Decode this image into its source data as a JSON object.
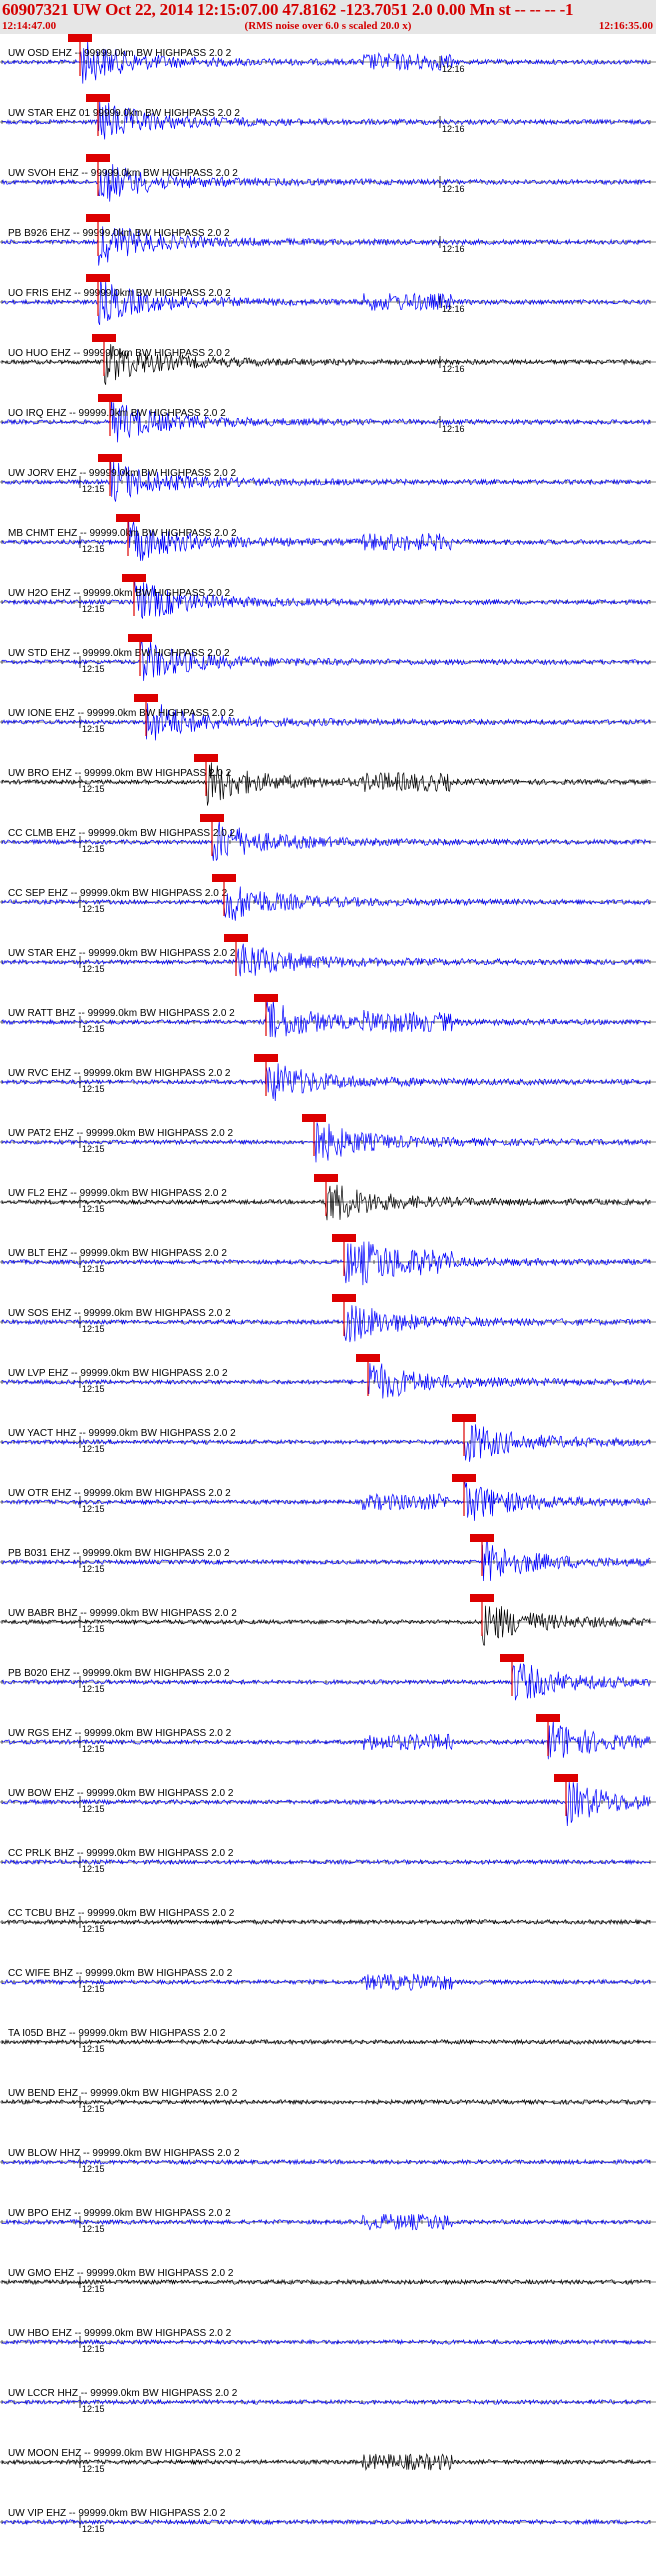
{
  "header": {
    "title": "60907321 UW Oct 22, 2014 12:15:07.00   47.8162 -123.7051  2.0 0.00 Mn st -- -- --  -1",
    "subtitle": "(RMS noise over 6.0 s scaled 20.0 x)",
    "start_time": "12:14:47.00",
    "end_time": "12:16:35.00"
  },
  "chart_data": {
    "type": "seismogram",
    "time_range": [
      "12:14:47.00",
      "12:16:35.00"
    ],
    "minute_marks": [
      {
        "label": "12:15",
        "t_sec": 13
      },
      {
        "label": "12:16",
        "t_sec": 73
      }
    ],
    "trace_color": "#0000ff",
    "alt_trace_color": "#000000",
    "pick_color": "#dd0000",
    "traces": [
      {
        "label": "UW OSD EHZ -- 99999.0km BW  HIGHPASS  2.0  2",
        "pick_t": 13,
        "tick": "12:16"
      },
      {
        "label": "UW STAR EHZ 01 99999.0km BW  HIGHPASS  2.0  2",
        "pick_t": 16,
        "tick": "12:16"
      },
      {
        "label": "UW SVOH EHZ -- 99999.0km BW  HIGHPASS  2.0  2",
        "pick_t": 16,
        "tick": "12:16"
      },
      {
        "label": "PB B926 EHZ -- 99999.0km BW  HIGHPASS  2.0  2",
        "pick_t": 16,
        "tick": "12:16"
      },
      {
        "label": "UO FRIS EHZ -- 99999.0km BW  HIGHPASS  2.0  2",
        "pick_t": 16,
        "tick": "12:16"
      },
      {
        "label": "UO HUO EHZ -- 99999.0km BW  HIGHPASS  2.0  2",
        "pick_t": 17,
        "tick": "12:16"
      },
      {
        "label": "UO IRQ EHZ -- 99999.0km BW  HIGHPASS  2.0  2",
        "pick_t": 18,
        "tick": "12:16"
      },
      {
        "label": "UW JORV EHZ -- 99999.0km BW  HIGHPASS  2.0  2",
        "pick_t": 18,
        "tick": "12:15"
      },
      {
        "label": "MB CHMT EHZ -- 99999.0km BW  HIGHPASS  2.0  2",
        "pick_t": 21,
        "tick": "12:15"
      },
      {
        "label": "UW H2O EHZ -- 99999.0km BW  HIGHPASS  2.0  2",
        "pick_t": 22,
        "tick": "12:15"
      },
      {
        "label": "UW STD EHZ -- 99999.0km BW  HIGHPASS  2.0  2",
        "pick_t": 23,
        "tick": "12:15"
      },
      {
        "label": "UW IONE EHZ -- 99999.0km BW  HIGHPASS  2.0  2",
        "pick_t": 24,
        "tick": "12:15"
      },
      {
        "label": "UW BRO EHZ -- 99999.0km BW  HIGHPASS  2.0  2",
        "pick_t": 34,
        "tick": "12:15"
      },
      {
        "label": "CC CLMB EHZ -- 99999.0km BW  HIGHPASS  2.0  2",
        "pick_t": 35,
        "tick": "12:15"
      },
      {
        "label": "CC SEP EHZ -- 99999.0km BW  HIGHPASS  2.0  2",
        "pick_t": 37,
        "tick": "12:15"
      },
      {
        "label": "UW STAR EHZ -- 99999.0km BW  HIGHPASS  2.0  2",
        "pick_t": 39,
        "tick": "12:15"
      },
      {
        "label": "UW RATT BHZ -- 99999.0km BW  HIGHPASS  2.0  2",
        "pick_t": 44,
        "tick": "12:15"
      },
      {
        "label": "UW RVC EHZ -- 99999.0km BW  HIGHPASS  2.0  2",
        "pick_t": 44,
        "tick": "12:15"
      },
      {
        "label": "UW PAT2 EHZ -- 99999.0km BW  HIGHPASS  2.0  2",
        "pick_t": 52,
        "tick": "12:15"
      },
      {
        "label": "UW FL2 EHZ -- 99999.0km BW  HIGHPASS  2.0  2",
        "pick_t": 54,
        "tick": "12:15"
      },
      {
        "label": "UW BLT EHZ -- 99999.0km BW  HIGHPASS  2.0  2",
        "pick_t": 57,
        "tick": "12:15"
      },
      {
        "label": "UW SOS EHZ -- 99999.0km BW  HIGHPASS  2.0  2",
        "pick_t": 57,
        "tick": "12:15"
      },
      {
        "label": "UW LVP EHZ -- 99999.0km BW  HIGHPASS  2.0  2",
        "pick_t": 61,
        "tick": "12:15"
      },
      {
        "label": "UW YACT HHZ -- 99999.0km BW  HIGHPASS  2.0  2",
        "pick_t": 77,
        "tick": "12:15"
      },
      {
        "label": "UW OTR EHZ -- 99999.0km BW  HIGHPASS  2.0  2",
        "pick_t": 77,
        "tick": "12:15"
      },
      {
        "label": "PB B031 EHZ -- 99999.0km BW  HIGHPASS  2.0  2",
        "pick_t": 80,
        "tick": "12:15"
      },
      {
        "label": "UW BABR BHZ -- 99999.0km BW  HIGHPASS  2.0  2",
        "pick_t": 80,
        "tick": "12:15"
      },
      {
        "label": "PB B020 EHZ -- 99999.0km BW  HIGHPASS  2.0  2",
        "pick_t": 85,
        "tick": "12:15"
      },
      {
        "label": "UW RGS EHZ -- 99999.0km BW  HIGHPASS  2.0  2",
        "pick_t": 91,
        "tick": "12:15"
      },
      {
        "label": "UW BOW EHZ -- 99999.0km BW  HIGHPASS  2.0  2",
        "pick_t": 94,
        "tick": "12:15"
      },
      {
        "label": "CC PRLK BHZ -- 99999.0km BW  HIGHPASS  2.0  2",
        "pick_t": null,
        "tick": "12:15"
      },
      {
        "label": "CC TCBU BHZ -- 99999.0km BW  HIGHPASS  2.0  2",
        "pick_t": null,
        "tick": "12:15"
      },
      {
        "label": "CC WIFE BHZ -- 99999.0km BW  HIGHPASS  2.0  2",
        "pick_t": null,
        "tick": "12:15"
      },
      {
        "label": "TA I05D BHZ -- 99999.0km BW  HIGHPASS  2.0  2",
        "pick_t": null,
        "tick": "12:15"
      },
      {
        "label": "UW BEND EHZ -- 99999.0km BW  HIGHPASS  2.0  2",
        "pick_t": null,
        "tick": "12:15"
      },
      {
        "label": "UW BLOW HHZ -- 99999.0km BW  HIGHPASS  2.0  2",
        "pick_t": null,
        "tick": "12:15"
      },
      {
        "label": "UW BPO EHZ -- 99999.0km BW  HIGHPASS  2.0  2",
        "pick_t": null,
        "tick": "12:15"
      },
      {
        "label": "UW GMO EHZ -- 99999.0km BW  HIGHPASS  2.0  2",
        "pick_t": null,
        "tick": "12:15"
      },
      {
        "label": "UW HBO EHZ -- 99999.0km BW  HIGHPASS  2.0  2",
        "pick_t": null,
        "tick": "12:15"
      },
      {
        "label": "UW LCCR HHZ -- 99999.0km BW  HIGHPASS  2.0  2",
        "pick_t": null,
        "tick": "12:15"
      },
      {
        "label": "UW MOON EHZ -- 99999.0km BW  HIGHPASS  2.0  2",
        "pick_t": null,
        "tick": "12:15"
      },
      {
        "label": "UW VIP EHZ -- 99999.0km BW  HIGHPASS  2.0  2",
        "pick_t": null,
        "tick": "12:15"
      }
    ]
  }
}
